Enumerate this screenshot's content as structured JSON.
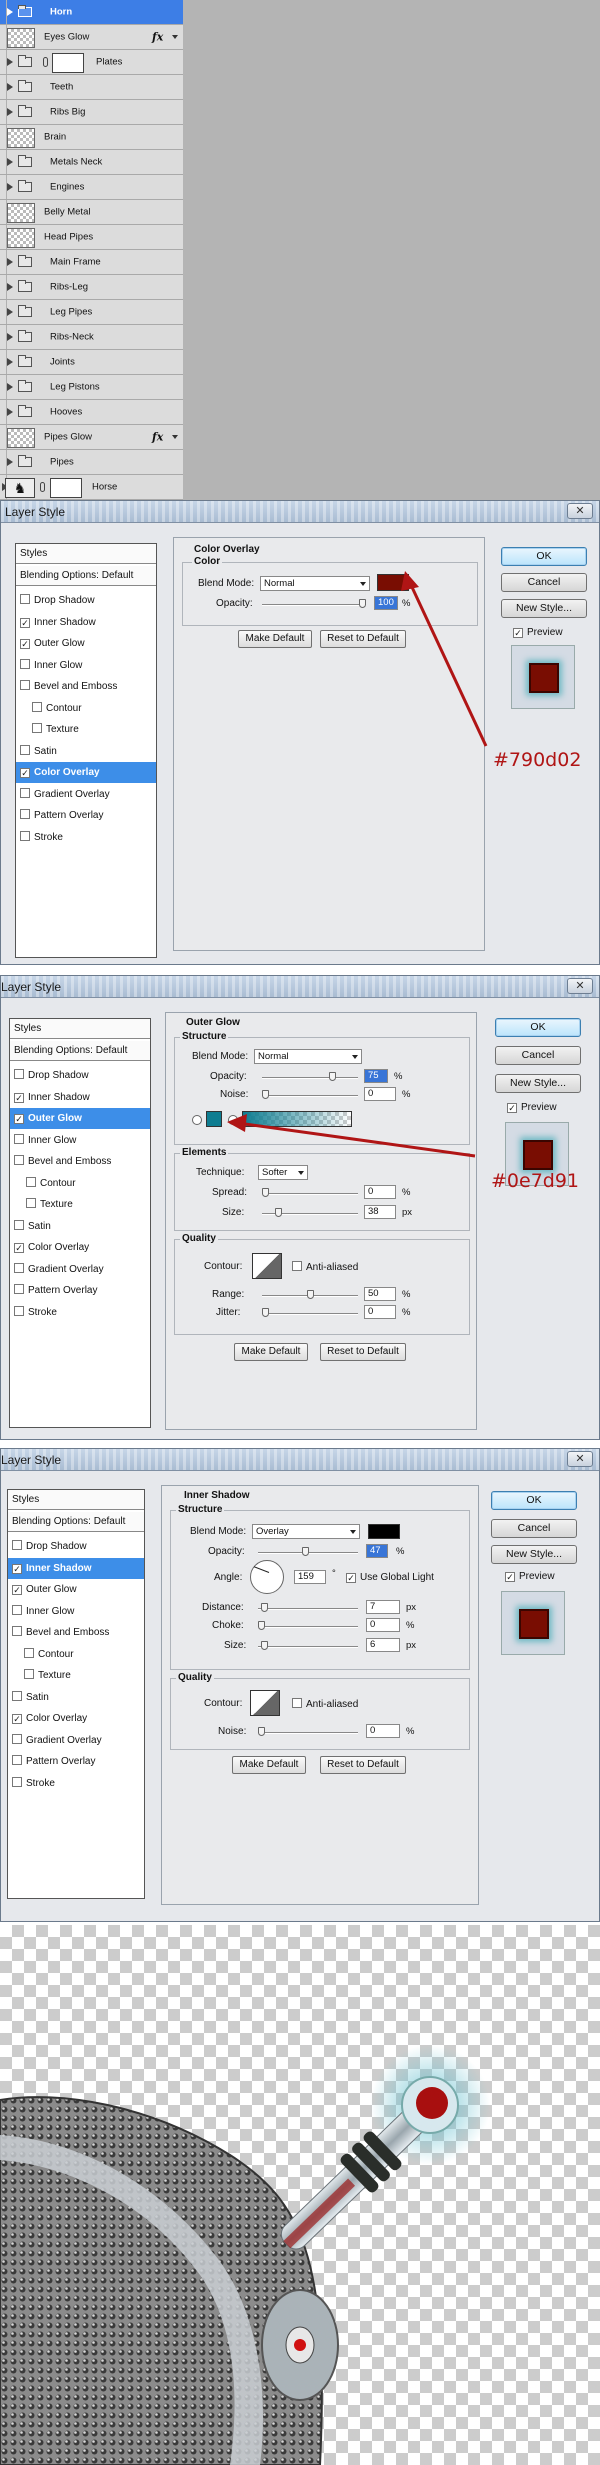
{
  "layers": [
    {
      "name": "Horn",
      "kind": "group",
      "selected": true
    },
    {
      "name": "Eyes Glow",
      "kind": "layer",
      "fx": true
    },
    {
      "name": "Plates",
      "kind": "group-mask"
    },
    {
      "name": "Teeth",
      "kind": "group"
    },
    {
      "name": "Ribs Big",
      "kind": "group"
    },
    {
      "name": "Brain",
      "kind": "layer"
    },
    {
      "name": "Metals Neck",
      "kind": "group"
    },
    {
      "name": "Engines",
      "kind": "group"
    },
    {
      "name": "Belly Metal",
      "kind": "layer"
    },
    {
      "name": "Head Pipes",
      "kind": "layer"
    },
    {
      "name": "Main Frame",
      "kind": "group"
    },
    {
      "name": "Ribs-Leg",
      "kind": "group"
    },
    {
      "name": "Leg Pipes",
      "kind": "group"
    },
    {
      "name": "Ribs-Neck",
      "kind": "group"
    },
    {
      "name": "Joints",
      "kind": "group"
    },
    {
      "name": "Leg Pistons",
      "kind": "group"
    },
    {
      "name": "Hooves",
      "kind": "group"
    },
    {
      "name": "Pipes Glow",
      "kind": "layer",
      "fx": true
    },
    {
      "name": "Pipes",
      "kind": "group"
    },
    {
      "name": "Horse",
      "kind": "horse"
    }
  ],
  "fx_label": "fx",
  "dialog_title": "Layer Style",
  "close_label": "✕",
  "styles_header": "Styles",
  "blending_options": "Blending Options: Default",
  "buttons": {
    "ok": "OK",
    "cancel": "Cancel",
    "new_style": "New Style...",
    "preview": "Preview",
    "make_default": "Make Default",
    "reset_default": "Reset to Default"
  },
  "dialog1": {
    "styles": [
      {
        "label": "Drop Shadow",
        "checked": false
      },
      {
        "label": "Inner Shadow",
        "checked": true
      },
      {
        "label": "Outer Glow",
        "checked": true
      },
      {
        "label": "Inner Glow",
        "checked": false
      },
      {
        "label": "Bevel and Emboss",
        "checked": false
      },
      {
        "label": "Contour",
        "checked": false,
        "indent": true
      },
      {
        "label": "Texture",
        "checked": false,
        "indent": true
      },
      {
        "label": "Satin",
        "checked": false
      },
      {
        "label": "Color Overlay",
        "checked": true,
        "active": true
      },
      {
        "label": "Gradient Overlay",
        "checked": false
      },
      {
        "label": "Pattern Overlay",
        "checked": false
      },
      {
        "label": "Stroke",
        "checked": false
      }
    ],
    "section": "Color Overlay",
    "group": "Color",
    "blend_mode_label": "Blend Mode:",
    "blend_mode": "Normal",
    "opacity_label": "Opacity:",
    "opacity": "100",
    "opacity_pct": 100,
    "color": "#790d02",
    "annotation": "#790d02"
  },
  "dialog2": {
    "styles": [
      {
        "label": "Drop Shadow",
        "checked": false
      },
      {
        "label": "Inner Shadow",
        "checked": true
      },
      {
        "label": "Outer Glow",
        "checked": true,
        "active": true
      },
      {
        "label": "Inner Glow",
        "checked": false
      },
      {
        "label": "Bevel and Emboss",
        "checked": false
      },
      {
        "label": "Contour",
        "checked": false,
        "indent": true
      },
      {
        "label": "Texture",
        "checked": false,
        "indent": true
      },
      {
        "label": "Satin",
        "checked": false
      },
      {
        "label": "Color Overlay",
        "checked": true
      },
      {
        "label": "Gradient Overlay",
        "checked": false
      },
      {
        "label": "Pattern Overlay",
        "checked": false
      },
      {
        "label": "Stroke",
        "checked": false
      }
    ],
    "section": "Outer Glow",
    "structure": "Structure",
    "blend_mode_label": "Blend Mode:",
    "blend_mode": "Normal",
    "opacity_label": "Opacity:",
    "opacity": "75",
    "opacity_pct": 75,
    "noise_label": "Noise:",
    "noise": "0",
    "noise_pct": 0,
    "glow_color": "#0e7d91",
    "elements": "Elements",
    "technique_label": "Technique:",
    "technique": "Softer",
    "spread_label": "Spread:",
    "spread": "0",
    "spread_pct": 0,
    "size_label": "Size:",
    "size": "38",
    "size_pct": 15,
    "quality": "Quality",
    "contour_label": "Contour:",
    "anti_aliased": "Anti-aliased",
    "range_label": "Range:",
    "range": "50",
    "range_pct": 50,
    "jitter_label": "Jitter:",
    "jitter": "0",
    "jitter_pct": 0,
    "annotation": "#0e7d91"
  },
  "dialog3": {
    "styles": [
      {
        "label": "Drop Shadow",
        "checked": false
      },
      {
        "label": "Inner Shadow",
        "checked": true,
        "active": true
      },
      {
        "label": "Outer Glow",
        "checked": true
      },
      {
        "label": "Inner Glow",
        "checked": false
      },
      {
        "label": "Bevel and Emboss",
        "checked": false
      },
      {
        "label": "Contour",
        "checked": false,
        "indent": true
      },
      {
        "label": "Texture",
        "checked": false,
        "indent": true
      },
      {
        "label": "Satin",
        "checked": false
      },
      {
        "label": "Color Overlay",
        "checked": true
      },
      {
        "label": "Gradient Overlay",
        "checked": false
      },
      {
        "label": "Pattern Overlay",
        "checked": false
      },
      {
        "label": "Stroke",
        "checked": false
      }
    ],
    "section": "Inner Shadow",
    "structure": "Structure",
    "blend_mode_label": "Blend Mode:",
    "blend_mode": "Overlay",
    "shadow_color": "#000000",
    "opacity_label": "Opacity:",
    "opacity": "47",
    "opacity_pct": 47,
    "angle_label": "Angle:",
    "angle": "159",
    "angle_unit": "°",
    "global_light": "Use Global Light",
    "distance_label": "Distance:",
    "distance": "7",
    "distance_pct": 3,
    "choke_label": "Choke:",
    "choke": "0",
    "choke_pct": 0,
    "size_label": "Size:",
    "size": "6",
    "size_pct": 3,
    "quality": "Quality",
    "contour_label": "Contour:",
    "anti_aliased": "Anti-aliased",
    "noise_label": "Noise:",
    "noise": "0",
    "noise_pct": 0
  },
  "units": {
    "pct": "%",
    "px": "px"
  }
}
